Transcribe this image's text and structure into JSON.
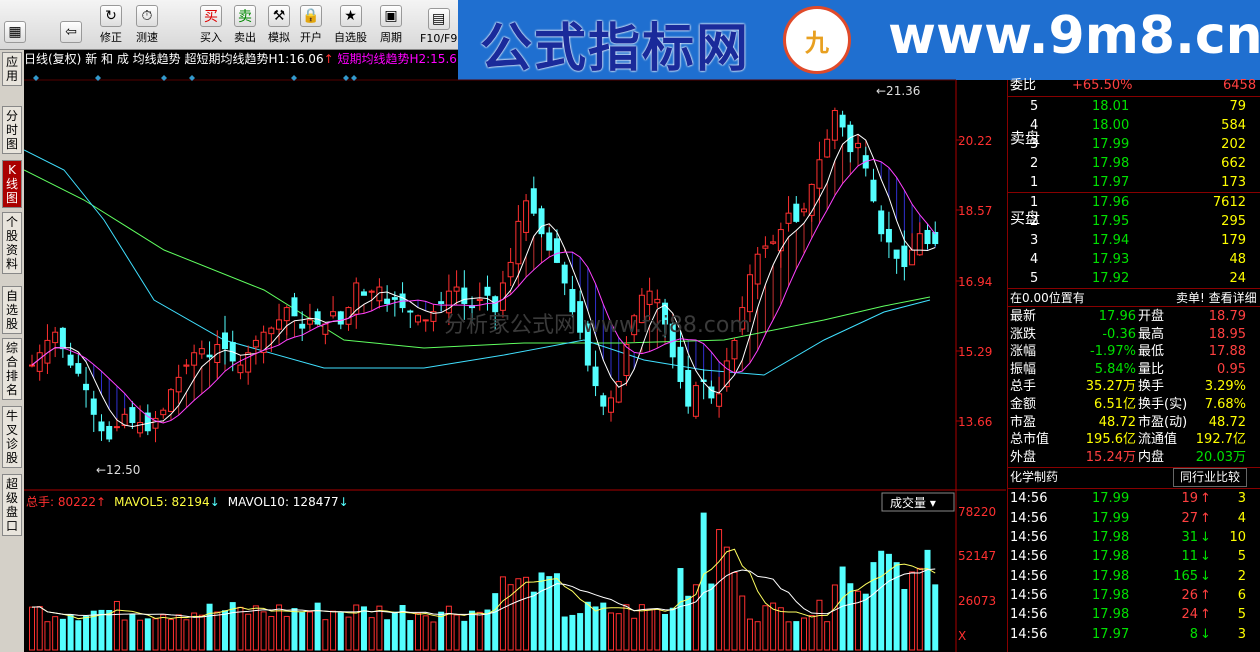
{
  "toolbar": [
    {
      "label": "",
      "icon": "app-icon"
    },
    {
      "label": "",
      "icon": "back-icon"
    },
    {
      "label": "修正",
      "icon": "revise-icon"
    },
    {
      "label": "测速",
      "icon": "speed-test-icon"
    },
    {
      "label": "买入",
      "icon": "buy-icon"
    },
    {
      "label": "卖出",
      "icon": "sell-icon"
    },
    {
      "label": "模拟",
      "icon": "simulate-icon"
    },
    {
      "label": "开户",
      "icon": "open-account-icon"
    },
    {
      "label": "自选股",
      "icon": "watchlist-icon"
    },
    {
      "label": "周期",
      "icon": "period-icon"
    },
    {
      "label": "F10/F9",
      "icon": "f10-icon"
    }
  ],
  "banner": {
    "title": "公式指标网",
    "url": "www.9m8.cn",
    "logo": "九"
  },
  "left_tabs": [
    "应用",
    "分时图",
    "K线图",
    "个股资料",
    "自选股",
    "综合排名",
    "牛叉诊股",
    "超级盘口"
  ],
  "info": {
    "mode": "日线(复权)",
    "items": "新 和 成",
    "ind1": "均线趋势",
    "ind2": "超短期均线趋势H1:",
    "h1": "16.06",
    "h2label": "短期均线趋势H2:",
    "h2": "15.6"
  },
  "price_axis": [
    "20.22",
    "18.57",
    "16.94",
    "15.29",
    "13.66"
  ],
  "hi_label": "21.36",
  "lo_label": "12.50",
  "vol_info": {
    "total_label": "总手:",
    "total": "80222",
    "mv5_label": "MAVOL5:",
    "mv5": "82194",
    "mv10_label": "MAVOL10:",
    "mv10": "128477"
  },
  "vol_axis": [
    "78220",
    "52147",
    "26073",
    "X"
  ],
  "vol_selector": "成交量",
  "wm": "分析家公式网 www.fxj88.com",
  "right": {
    "weibi": {
      "label": "委比",
      "val": "+65.50%",
      "diff": "6458"
    },
    "sell_label": "卖盘",
    "buy_label": "买盘",
    "sell": [
      {
        "n": "5",
        "p": "18.01",
        "v": "79"
      },
      {
        "n": "4",
        "p": "18.00",
        "v": "584"
      },
      {
        "n": "3",
        "p": "17.99",
        "v": "202"
      },
      {
        "n": "2",
        "p": "17.98",
        "v": "662"
      },
      {
        "n": "1",
        "p": "17.97",
        "v": "173"
      }
    ],
    "buy": [
      {
        "n": "1",
        "p": "17.96",
        "v": "7612"
      },
      {
        "n": "2",
        "p": "17.95",
        "v": "295"
      },
      {
        "n": "3",
        "p": "17.94",
        "v": "179"
      },
      {
        "n": "4",
        "p": "17.93",
        "v": "48"
      },
      {
        "n": "5",
        "p": "17.92",
        "v": "24"
      }
    ],
    "position": "在0.00位置有",
    "detail": "卖单! 查看详细",
    "quotes": [
      {
        "l": "最新",
        "v": "17.96",
        "l2": "开盘",
        "v2": "18.79"
      },
      {
        "l": "涨跌",
        "v": "-0.36",
        "l2": "最高",
        "v2": "18.95"
      },
      {
        "l": "涨幅",
        "v": "-1.97%",
        "l2": "最低",
        "v2": "17.88"
      },
      {
        "l": "振幅",
        "v": "5.84%",
        "l2": "量比",
        "v2": "0.95"
      },
      {
        "l": "总手",
        "v": "35.27万",
        "l2": "换手",
        "v2": "3.29%"
      },
      {
        "l": "金额",
        "v": "6.51亿",
        "l2": "换手(实)",
        "v2": "7.68%"
      },
      {
        "l": "市盈",
        "v": "48.72",
        "l2": "市盈(动)",
        "v2": "48.72"
      },
      {
        "l": "总市值",
        "v": "195.6亿",
        "l2": "流通值",
        "v2": "192.7亿"
      },
      {
        "l": "外盘",
        "v": "15.24万",
        "l2": "内盘",
        "v2": "20.03万"
      }
    ],
    "industry": "化学制药",
    "compare": "同行业比较",
    "ticks": [
      {
        "t": "14:56",
        "p": "17.99",
        "v": "19",
        "d": "up",
        "n": "3"
      },
      {
        "t": "14:56",
        "p": "17.99",
        "v": "27",
        "d": "up",
        "n": "4"
      },
      {
        "t": "14:56",
        "p": "17.98",
        "v": "31",
        "d": "down",
        "n": "10"
      },
      {
        "t": "14:56",
        "p": "17.98",
        "v": "11",
        "d": "down",
        "n": "5"
      },
      {
        "t": "14:56",
        "p": "17.98",
        "v": "165",
        "d": "down",
        "n": "2"
      },
      {
        "t": "14:56",
        "p": "17.98",
        "v": "26",
        "d": "up",
        "n": "6"
      },
      {
        "t": "14:56",
        "p": "17.98",
        "v": "24",
        "d": "up",
        "n": "5"
      },
      {
        "t": "14:56",
        "p": "17.97",
        "v": "8",
        "d": "down",
        "n": "3"
      }
    ]
  },
  "colors": {
    "up": "#ff3030",
    "down": "#54ffff",
    "ma1": "#ffffff",
    "ma2": "#ff40ff",
    "ma3": "#60ff60",
    "ma4": "#40e0ff"
  }
}
